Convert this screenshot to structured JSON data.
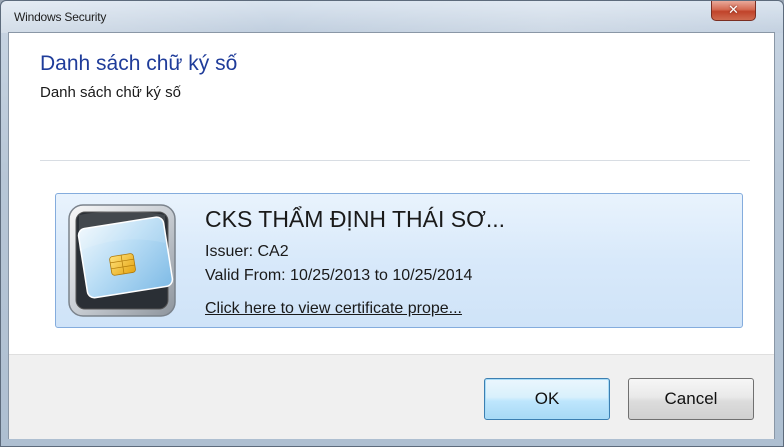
{
  "window": {
    "title": "Windows Security",
    "close_glyph": "✕"
  },
  "dialog": {
    "heading": "Danh sách chữ ký số",
    "subheading": "Danh sách chữ ký số"
  },
  "certificate": {
    "name": "CKS THẨM ĐỊNH THÁI SƠ...",
    "issuer": "Issuer: CA2",
    "valid": "Valid From: 10/25/2013 to 10/25/2014",
    "link": "Click here to view certificate prope...",
    "icon": "smart-card-icon"
  },
  "buttons": {
    "ok_label": "OK",
    "cancel_label": "Cancel"
  },
  "colors": {
    "heading": "#1f3c9a",
    "tile_border": "#84acdd",
    "close": "#c0432a"
  }
}
